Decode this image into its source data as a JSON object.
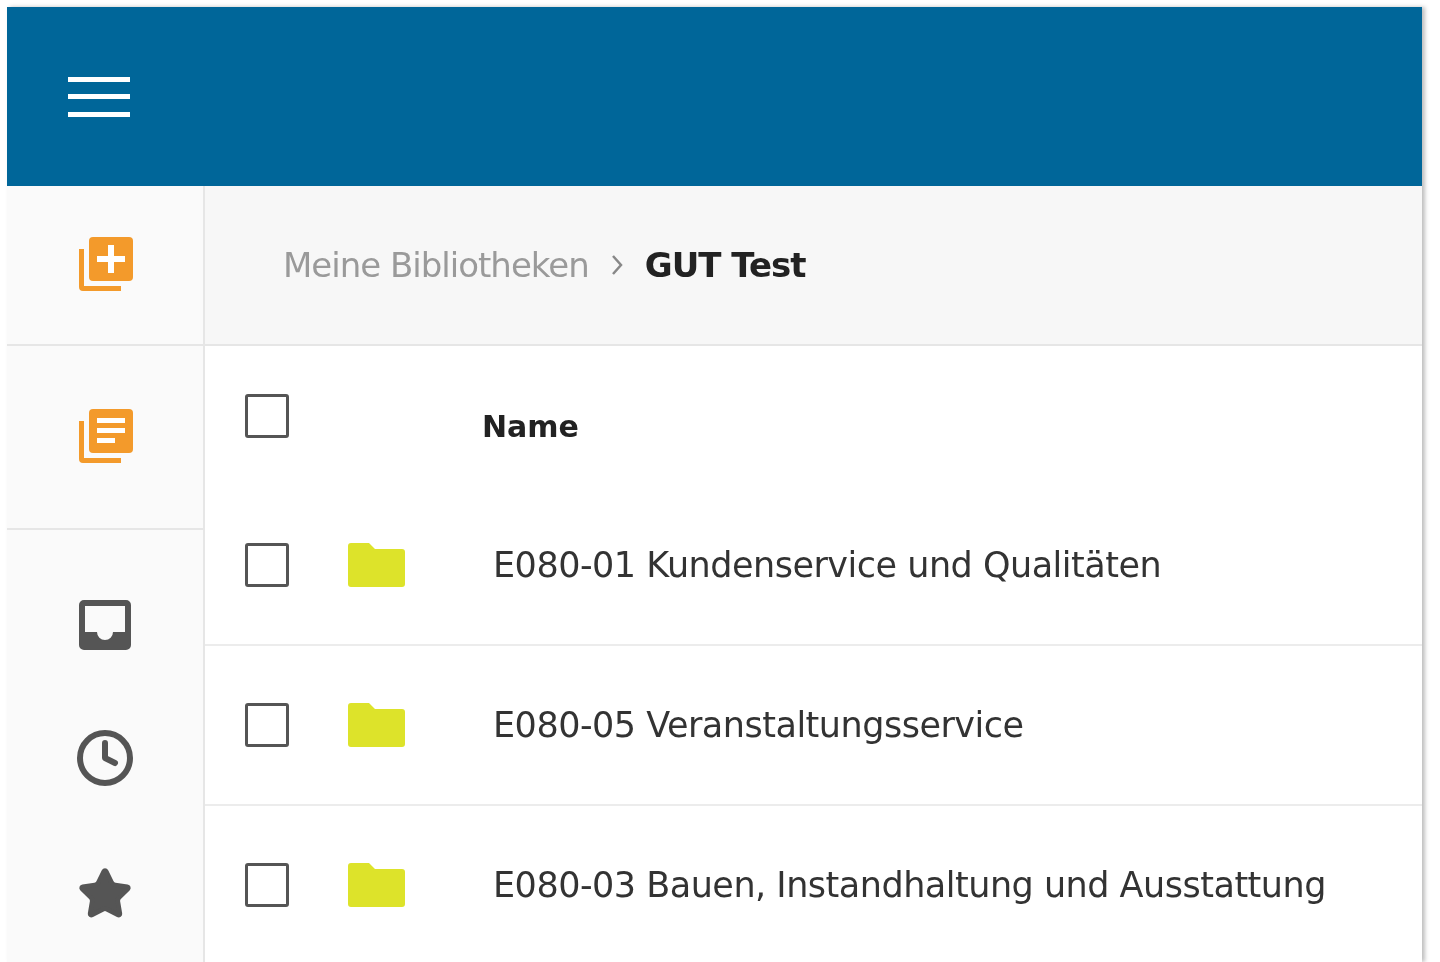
{
  "breadcrumb": [
    {
      "label": "Meine Bibliotheken",
      "current": false
    },
    {
      "label": "GUT Test",
      "current": true
    }
  ],
  "table": {
    "select_all_checked": false,
    "columns": [
      "Name"
    ],
    "rows": [
      {
        "name": "E080-01 Kundenservice und Qualitäten",
        "checked": false
      },
      {
        "name": "E080-05 Veranstaltungsservice",
        "checked": false
      },
      {
        "name": "E080-03 Bauen, Instandhaltung und Ausstattung",
        "checked": false
      }
    ]
  }
}
